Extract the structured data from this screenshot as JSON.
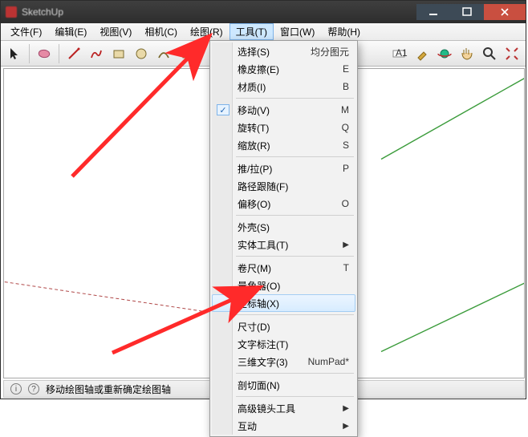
{
  "titlebar": {
    "text": "SketchUp"
  },
  "menubar": {
    "items": [
      {
        "label": "文件(F)"
      },
      {
        "label": "编辑(E)"
      },
      {
        "label": "视图(V)"
      },
      {
        "label": "相机(C)"
      },
      {
        "label": "绘图(R)"
      },
      {
        "label": "工具(T)"
      },
      {
        "label": "窗口(W)"
      },
      {
        "label": "帮助(H)"
      }
    ]
  },
  "dropdown": {
    "rows": [
      {
        "label": "选择(S)",
        "shortcut": "均分图元"
      },
      {
        "label": "橡皮擦(E)",
        "shortcut": "E"
      },
      {
        "label": "材质(I)",
        "shortcut": "B"
      }
    ],
    "rows2": [
      {
        "label": "移动(V)",
        "shortcut": "M",
        "checked": true
      },
      {
        "label": "旋转(T)",
        "shortcut": "Q"
      },
      {
        "label": "缩放(R)",
        "shortcut": "S"
      }
    ],
    "rows3": [
      {
        "label": "推/拉(P)",
        "shortcut": "P"
      },
      {
        "label": "路径跟随(F)",
        "shortcut": ""
      },
      {
        "label": "偏移(O)",
        "shortcut": "O"
      }
    ],
    "rows4": [
      {
        "label": "外壳(S)",
        "shortcut": ""
      },
      {
        "label": "实体工具(T)",
        "shortcut": "",
        "submenu": true
      }
    ],
    "rows5": [
      {
        "label": "卷尺(M)",
        "shortcut": "T"
      },
      {
        "label": "量角器(O)",
        "shortcut": ""
      },
      {
        "label": "坐标轴(X)",
        "shortcut": "",
        "hover": true
      }
    ],
    "rows6": [
      {
        "label": "尺寸(D)",
        "shortcut": ""
      },
      {
        "label": "文字标注(T)",
        "shortcut": ""
      },
      {
        "label": "三维文字(3)",
        "shortcut": "NumPad*"
      }
    ],
    "rows7": [
      {
        "label": "剖切面(N)",
        "shortcut": ""
      }
    ],
    "rows8": [
      {
        "label": "高级镜头工具",
        "shortcut": "",
        "submenu": true
      },
      {
        "label": "互动",
        "shortcut": "",
        "submenu": true
      }
    ]
  },
  "status": {
    "text": "移动绘图轴或重新确定绘图轴"
  },
  "icons": {
    "home": "⌂",
    "person": "👤",
    "info": "i"
  }
}
